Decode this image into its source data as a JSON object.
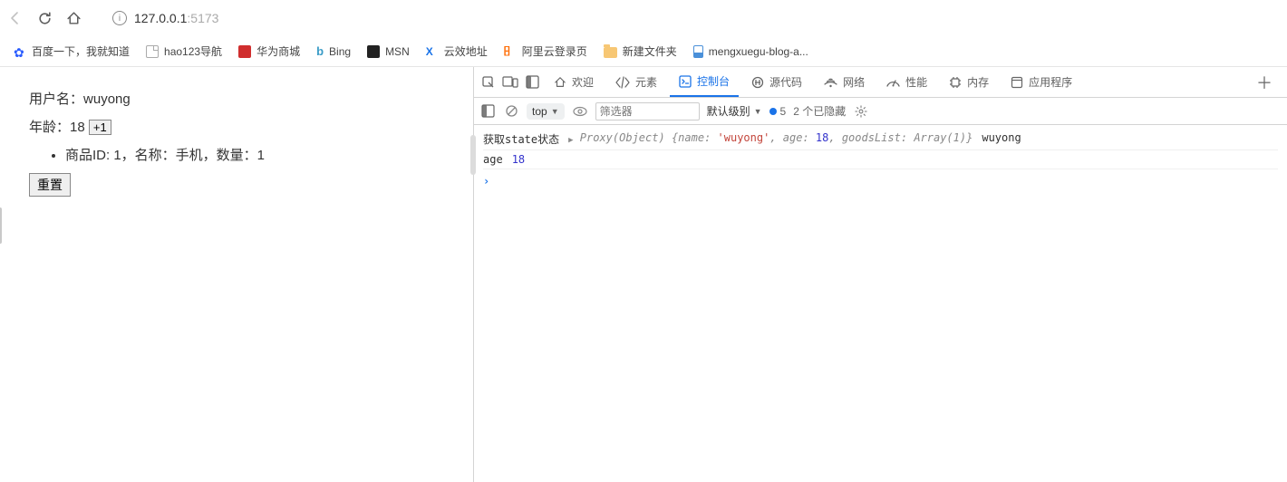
{
  "browser": {
    "url_host": "127.0.0.1",
    "url_port": ":5173"
  },
  "bookmarks": {
    "baidu": "百度一下，我就知道",
    "hao123": "hao123导航",
    "huawei": "华为商城",
    "bing": "Bing",
    "msn": "MSN",
    "yunxiao": "云效地址",
    "aliyun": "阿里云登录页",
    "newfolder": "新建文件夹",
    "mengxuegu": "mengxuegu-blog-a..."
  },
  "page": {
    "username_label": "用户名：",
    "username_value": "wuyong",
    "age_label": "年龄：",
    "age_value": "18",
    "plus_one": "+1",
    "item_text": "商品ID: 1，名称：手机，数量：1",
    "reset": "重置"
  },
  "devtools": {
    "tabs": {
      "welcome": "欢迎",
      "elements": "元素",
      "console": "控制台",
      "sources": "源代码",
      "network": "网络",
      "performance": "性能",
      "memory": "内存",
      "application": "应用程序"
    },
    "toolbar": {
      "context": "top",
      "filter_placeholder": "筛选器",
      "level": "默认级别",
      "issues_count": "5",
      "hidden_text": "2 个已隐藏"
    },
    "logs": {
      "row1_label": "获取state状态",
      "row1_proxy": "Proxy(Object)",
      "row1_name_key": "name:",
      "row1_name_val": "'wuyong'",
      "row1_age_key": "age:",
      "row1_age_val": "18",
      "row1_goods_key": "goodsList:",
      "row1_goods_val": "Array(1)",
      "row1_trail": "wuyong",
      "row2_label": "age",
      "row2_val": "18"
    }
  }
}
